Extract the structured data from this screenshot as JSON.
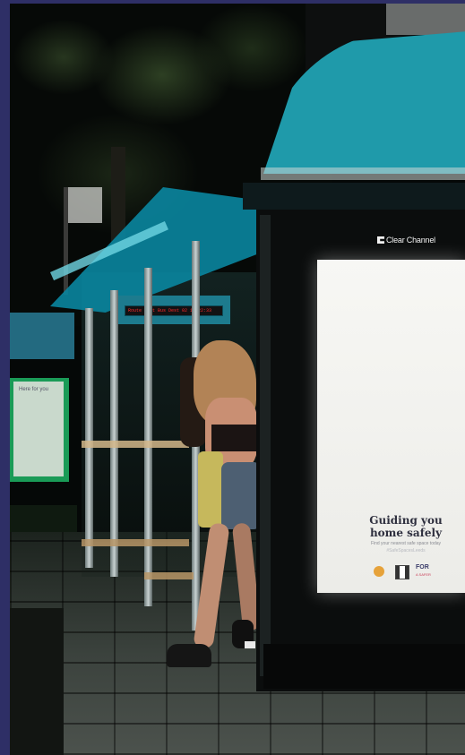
{
  "scene": {
    "description_colors": {
      "frame": "#2e2f66",
      "canopy": "#1f9aaa",
      "glass_tint": "#0a86a0"
    }
  },
  "bus_display": {
    "text": "Route Next Bus Dest 02 11:22:33"
  },
  "advert_panel": {
    "brand": "Clear Channel",
    "poster": {
      "headline_line1": "Guiding you",
      "headline_line2": "home safely",
      "subline": "Find your nearest safe space today",
      "hashtag": "#SafeSpacesLeeds",
      "partner_logo": "FOR",
      "partner_logo_sub": "A SAFER"
    }
  },
  "far_shelter_ad": {
    "text": "Here for you"
  }
}
